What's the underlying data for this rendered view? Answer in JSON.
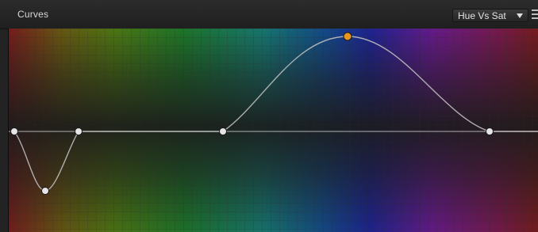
{
  "panel": {
    "title": "Curves"
  },
  "mode_select": {
    "selected": "Hue Vs Sat"
  },
  "icons": {
    "dropdown": "chevron-down-icon",
    "menu": "menu-icon"
  },
  "colors": {
    "active_point": "#e8961e",
    "point": "#e6e6e6",
    "curve": "#bdbdbd",
    "baseline": "#bdbdbd"
  }
}
